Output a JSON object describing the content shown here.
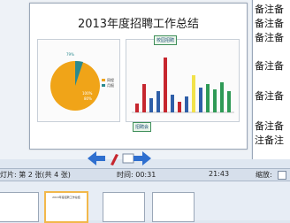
{
  "slide": {
    "title": "2013年度招聘工作总结",
    "pie_legend": [
      "同程",
      "月报"
    ],
    "pie_percents": [
      "79%",
      "100%",
      "80%"
    ],
    "callout_top": "校园招聘",
    "callout_bottom": "招聘会"
  },
  "notes": {
    "lines": [
      "备注备",
      "备注备",
      "备注备",
      "备注备",
      "备注备",
      "备注备",
      "注备注"
    ]
  },
  "status": {
    "slide_label": "灯片: 第 2 张(共 4 张)",
    "time_label": "时间: 00:31",
    "clock": "21:43",
    "zoom_label": "缩放:"
  },
  "colors": {
    "accent": "#f2b84b",
    "pie_main": "#f0a418",
    "pie_slice": "#2b8a8f",
    "bar_red": "#c6262e",
    "bar_green": "#2f9a56",
    "bar_blue": "#2f5fa8",
    "bar_yellow": "#f2e24a"
  },
  "icons": {
    "prev": "arrow-left-icon",
    "pen": "pen-icon",
    "next": "arrow-right-icon"
  }
}
